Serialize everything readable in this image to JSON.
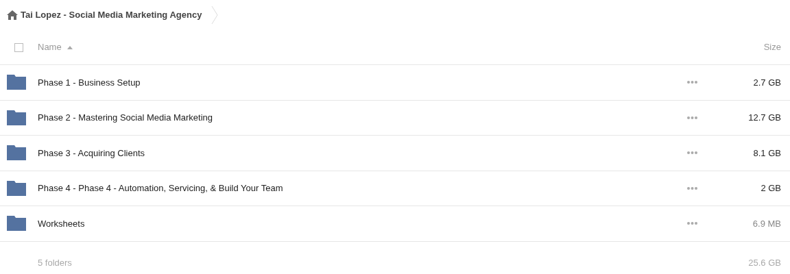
{
  "breadcrumb": {
    "title": "Tai Lopez - Social Media Marketing Agency"
  },
  "table": {
    "select_all": {
      "checked": false
    },
    "columns": [
      {
        "label": "Name",
        "sorted": true
      },
      {
        "label": "Size",
        "sorted": false
      }
    ],
    "rows": [
      {
        "name": "Phase 1 - Business Setup",
        "size": "2.7 GB",
        "size_dimmed": false
      },
      {
        "name": "Phase 2 - Mastering Social Media Marketing",
        "size": "12.7 GB",
        "size_dimmed": false
      },
      {
        "name": "Phase 3 - Acquiring Clients",
        "size": "8.1 GB",
        "size_dimmed": false
      },
      {
        "name": "Phase 4 - Phase 4 - Automation, Servicing, & Build Your Team",
        "size": "2 GB",
        "size_dimmed": false
      },
      {
        "name": "Worksheets",
        "size": "6.9 MB",
        "size_dimmed": true
      }
    ]
  },
  "footer": {
    "count": "5 folders",
    "total": "25.6 GB"
  }
}
